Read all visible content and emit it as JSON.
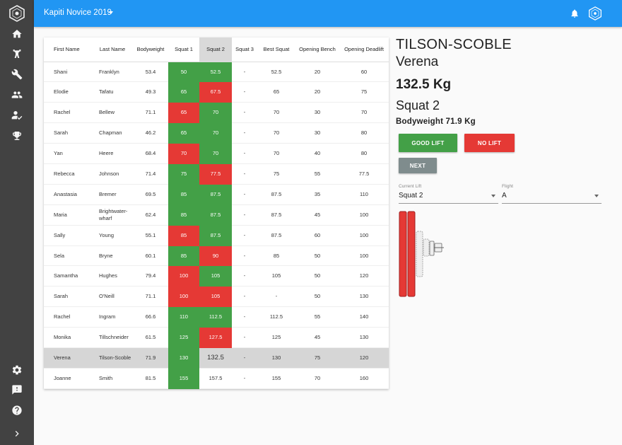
{
  "app": {
    "title": "Kapiti Novice 2019"
  },
  "sidebar": {
    "icons": [
      "logo-icon",
      "home-icon",
      "lifter-icon",
      "wrench-icon",
      "people-icon",
      "referee-icon",
      "trophy-icon",
      "settings-icon",
      "feedback-icon",
      "help-icon",
      "expand-icon"
    ]
  },
  "table": {
    "headers": [
      "First Name",
      "Last Name",
      "Bodyweight",
      "Squat 1",
      "Squat 2",
      "Squat 3",
      "Best Squat",
      "Opening Bench",
      "Opening Deadlift"
    ],
    "rows": [
      {
        "first": "Shani",
        "last": "Franklyn",
        "bw": "53.4",
        "s1": "50",
        "s2": "52.5",
        "s3": "-",
        "best": "52.5",
        "bench": "20",
        "dead": "60"
      },
      {
        "first": "Elodie",
        "last": "Tafatu",
        "bw": "49.3",
        "s1": "65",
        "s2": "67.5",
        "s3": "-",
        "best": "65",
        "bench": "20",
        "dead": "75"
      },
      {
        "first": "Rachel",
        "last": "Bellew",
        "bw": "71.1",
        "s1": "65",
        "s2": "70",
        "s3": "-",
        "best": "70",
        "bench": "30",
        "dead": "70"
      },
      {
        "first": "Sarah",
        "last": "Chapman",
        "bw": "46.2",
        "s1": "65",
        "s2": "70",
        "s3": "-",
        "best": "70",
        "bench": "30",
        "dead": "80"
      },
      {
        "first": "Yan",
        "last": "Heere",
        "bw": "68.4",
        "s1": "70",
        "s2": "70",
        "s3": "-",
        "best": "70",
        "bench": "40",
        "dead": "80"
      },
      {
        "first": "Rebecca",
        "last": "Johnson",
        "bw": "71.4",
        "s1": "75",
        "s2": "77.5",
        "s3": "-",
        "best": "75",
        "bench": "55",
        "dead": "77.5"
      },
      {
        "first": "Anastasia",
        "last": "Bremer",
        "bw": "69.5",
        "s1": "85",
        "s2": "87.5",
        "s3": "-",
        "best": "87.5",
        "bench": "35",
        "dead": "110"
      },
      {
        "first": "Maria",
        "last": "Brightwater-wharf",
        "bw": "62.4",
        "s1": "85",
        "s2": "87.5",
        "s3": "-",
        "best": "87.5",
        "bench": "45",
        "dead": "100"
      },
      {
        "first": "Sally",
        "last": "Young",
        "bw": "55.1",
        "s1": "85",
        "s2": "87.5",
        "s3": "-",
        "best": "87.5",
        "bench": "60",
        "dead": "100"
      },
      {
        "first": "Sela",
        "last": "Bryne",
        "bw": "60.1",
        "s1": "85",
        "s2": "90",
        "s3": "-",
        "best": "85",
        "bench": "50",
        "dead": "100"
      },
      {
        "first": "Samantha",
        "last": "Hughes",
        "bw": "79.4",
        "s1": "100",
        "s2": "105",
        "s3": "-",
        "best": "105",
        "bench": "50",
        "dead": "120"
      },
      {
        "first": "Sarah",
        "last": "O'Neill",
        "bw": "71.1",
        "s1": "100",
        "s2": "105",
        "s3": "-",
        "best": "-",
        "bench": "50",
        "dead": "130"
      },
      {
        "first": "Rachel",
        "last": "Ingram",
        "bw": "66.6",
        "s1": "110",
        "s2": "112.5",
        "s3": "-",
        "best": "112.5",
        "bench": "55",
        "dead": "140"
      },
      {
        "first": "Monika",
        "last": "Tillschneider",
        "bw": "61.5",
        "s1": "125",
        "s2": "127.5",
        "s3": "-",
        "best": "125",
        "bench": "45",
        "dead": "130"
      },
      {
        "first": "Verena",
        "last": "Tilson-Scoble",
        "bw": "71.9",
        "s1": "130",
        "s2": "132.5",
        "s3": "-",
        "best": "130",
        "bench": "75",
        "dead": "120"
      },
      {
        "first": "Joanne",
        "last": "Smith",
        "bw": "81.5",
        "s1": "155",
        "s2": "157.5",
        "s3": "-",
        "best": "155",
        "bench": "70",
        "dead": "160"
      }
    ]
  },
  "current": {
    "last_name": "TILSON-SCOBLE",
    "first_name": "Verena",
    "weight": "132.5 Kg",
    "lift": "Squat 2",
    "bodyweight": "Bodyweight 71.9 Kg"
  },
  "buttons": {
    "good": "GOOD LIFT",
    "bad": "NO LIFT",
    "next": "NEXT"
  },
  "selects": {
    "current_lift": {
      "label": "Current Lift",
      "value": "Squat 2"
    },
    "flight": {
      "label": "Flight",
      "value": "A"
    }
  },
  "colors": {
    "appbar": "#2196f3",
    "sidebar": "#424242",
    "good": "#43a047",
    "bad": "#e53935",
    "plate": "#e53935"
  }
}
